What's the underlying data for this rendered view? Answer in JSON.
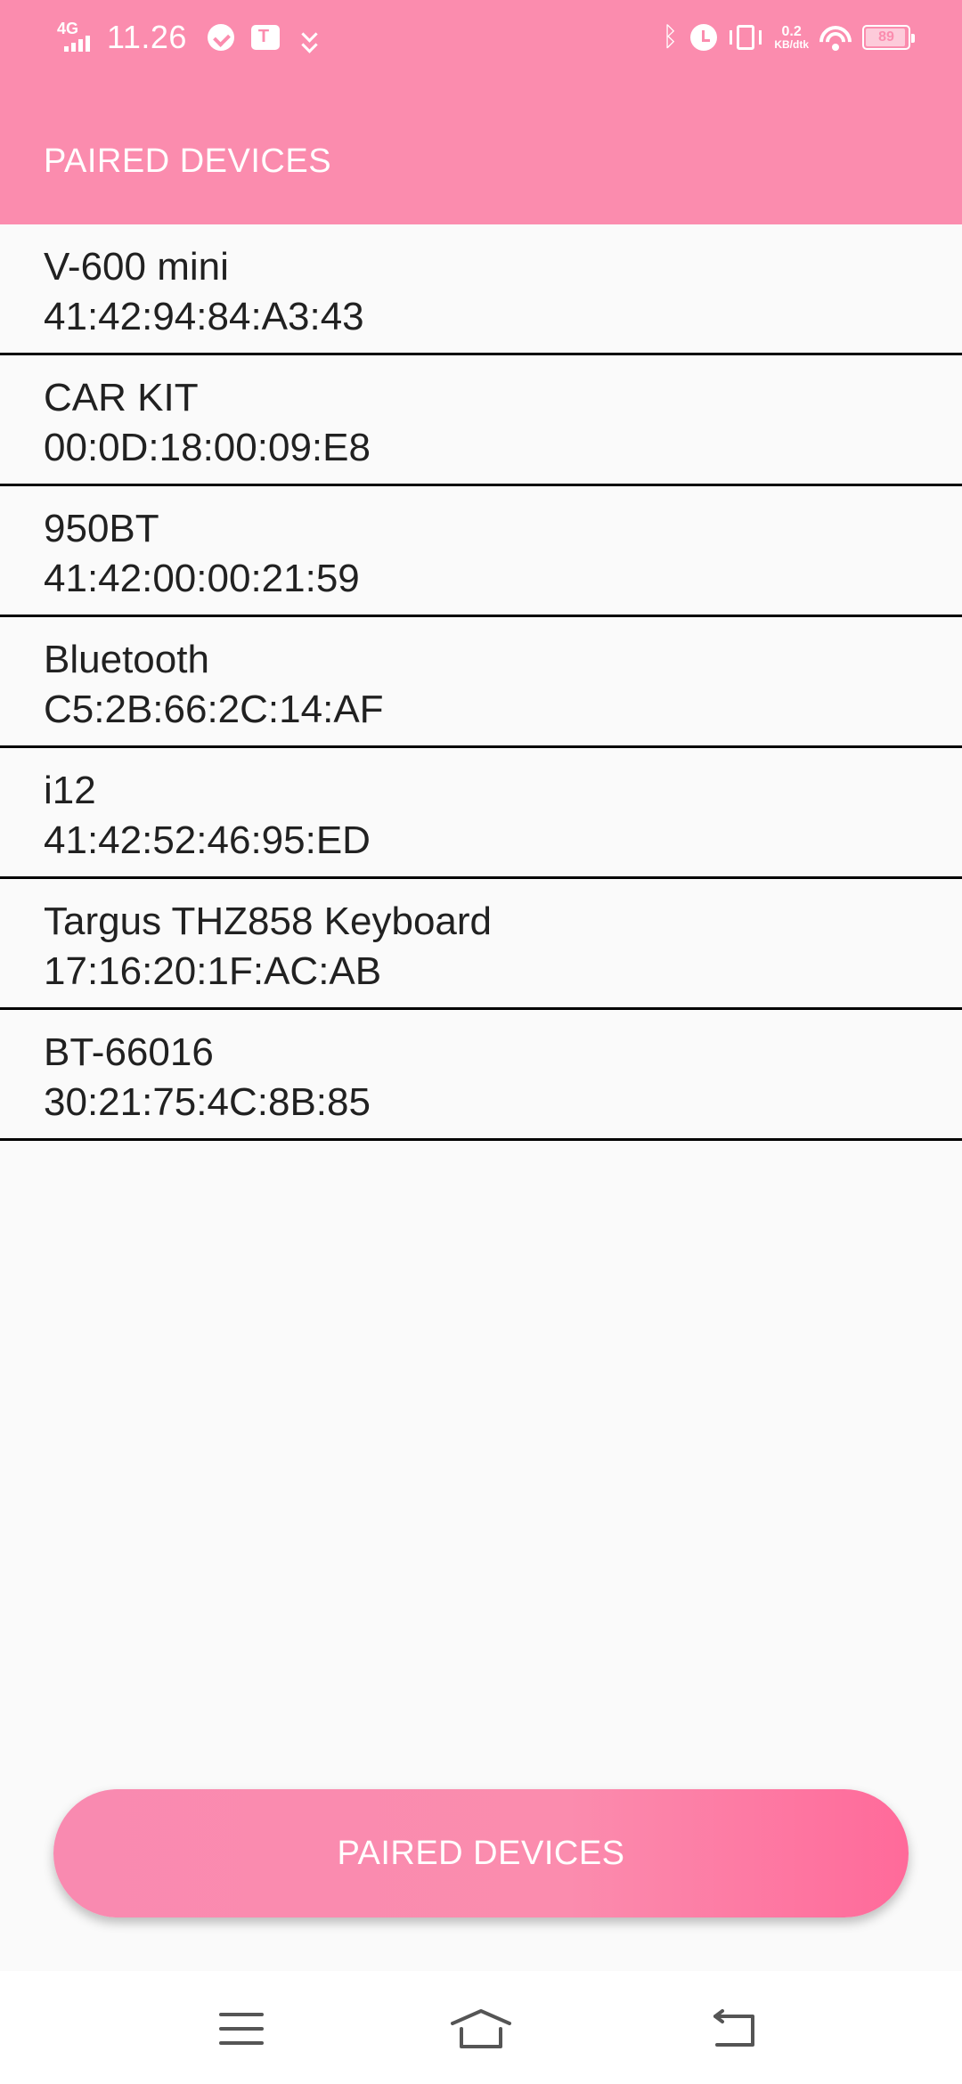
{
  "status_bar": {
    "network_type": "4G",
    "time": "11.26",
    "net_speed_value": "0.2",
    "net_speed_unit": "KB/dtk",
    "battery": "89",
    "icons": [
      "signal-icon",
      "telegram-icon",
      "teams-icon",
      "download-icon",
      "bluetooth-icon",
      "alarm-icon",
      "vibrate-icon",
      "wifi-icon",
      "battery-icon"
    ]
  },
  "app_bar": {
    "title": "PAIRED DEVICES"
  },
  "devices": [
    {
      "name": "V-600 mini",
      "address": "41:42:94:84:A3:43"
    },
    {
      "name": "CAR KIT",
      "address": "00:0D:18:00:09:E8"
    },
    {
      "name": "950BT",
      "address": "41:42:00:00:21:59"
    },
    {
      "name": "Bluetooth",
      "address": "C5:2B:66:2C:14:AF"
    },
    {
      "name": "i12",
      "address": "41:42:52:46:95:ED"
    },
    {
      "name": "Targus THZ858 Keyboard",
      "address": "17:16:20:1F:AC:AB"
    },
    {
      "name": "BT-66016",
      "address": "30:21:75:4C:8B:85"
    }
  ],
  "primary_button": {
    "label": "PAIRED DEVICES"
  },
  "nav_bar": {
    "icons": [
      "menu-icon",
      "home-icon",
      "back-icon"
    ]
  },
  "colors": {
    "accent": "#fb8cae",
    "button_gradient_end": "#ff6a9a",
    "background": "#fafafa",
    "divider": "#000000"
  }
}
